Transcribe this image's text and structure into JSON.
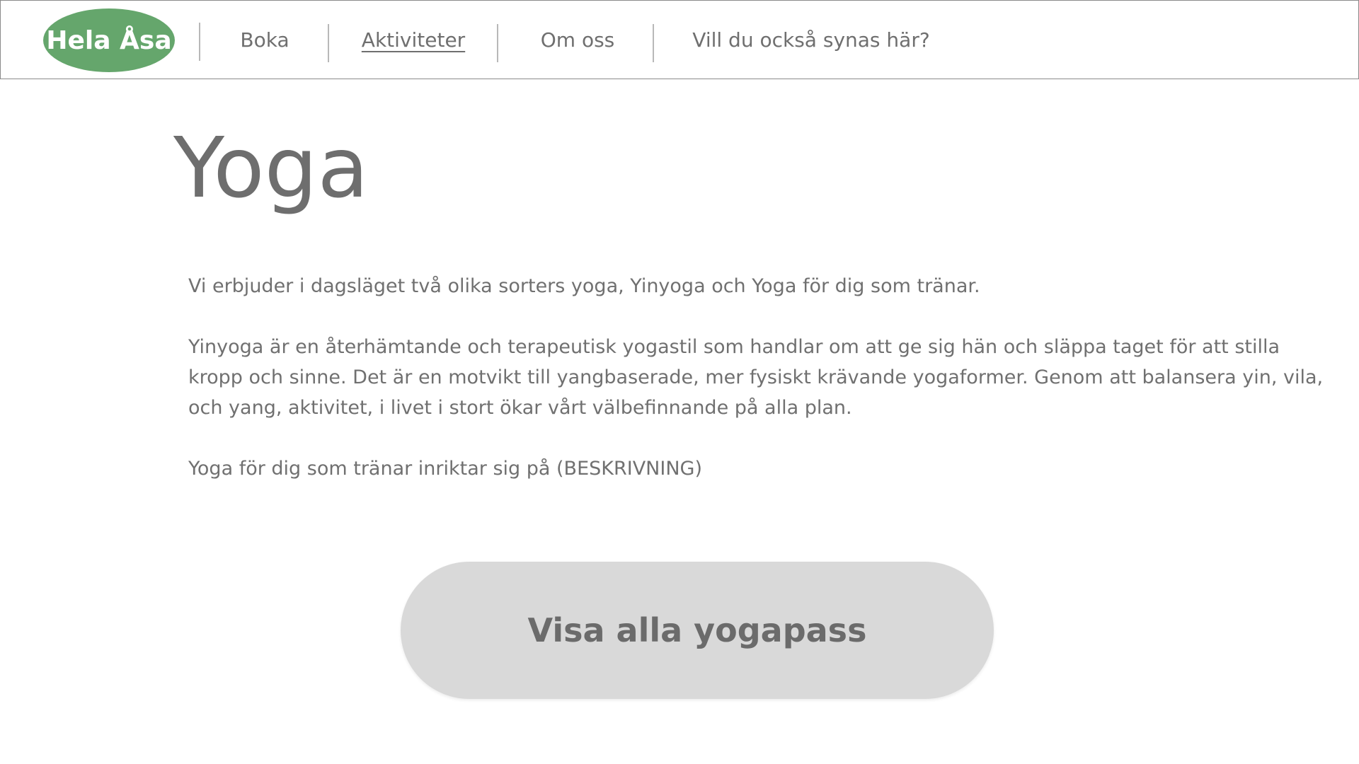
{
  "header": {
    "logo_text": "Hela Åsa",
    "logo_color": "#65a66c",
    "nav_items": [
      {
        "label": "Boka",
        "active": false
      },
      {
        "label": "Aktiviteter",
        "active": true
      },
      {
        "label": "Om oss",
        "active": false
      },
      {
        "label": "Vill du också synas här?",
        "active": false
      }
    ]
  },
  "main": {
    "title": "Yoga",
    "paragraphs": [
      "Vi erbjuder i dagsläget två olika sorters yoga, Yinyoga och Yoga för dig som tränar.",
      "Yinyoga är en återhämtande och terapeutisk yogastil som handlar om att ge sig hän och släppa taget för att stilla kropp och sinne. Det är en motvikt till yangbaserade, mer fysiskt krävande yogaformer. Genom att balansera yin, vila, och yang, aktivitet, i livet i stort ökar vårt välbefinnande på alla plan.",
      "Yoga för dig som tränar inriktar sig på (BESKRIVNING)"
    ],
    "cta_label": "Visa alla yogapass",
    "cta_color": "#d9d9d9"
  }
}
